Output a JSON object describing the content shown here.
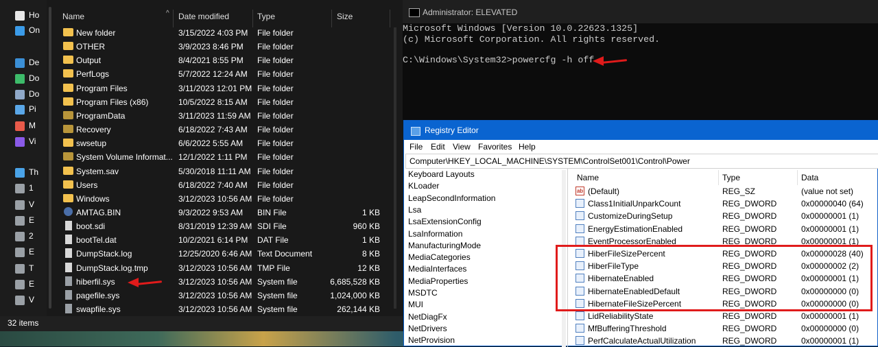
{
  "explorer": {
    "nav": [
      {
        "label": "Ho",
        "icon": "home-icon"
      },
      {
        "label": "On",
        "icon": "onedrive-icon"
      },
      {
        "label": "De",
        "icon": "desktop-icon"
      },
      {
        "label": "Do",
        "icon": "downloads-icon"
      },
      {
        "label": "Do",
        "icon": "documents-icon"
      },
      {
        "label": "Pi",
        "icon": "pictures-icon"
      },
      {
        "label": "M",
        "icon": "music-icon"
      },
      {
        "label": "Vi",
        "icon": "videos-icon"
      },
      {
        "label": "Th",
        "icon": "this-pc-icon"
      },
      {
        "label": "1",
        "icon": "drive-icon"
      },
      {
        "label": "V",
        "icon": "drive-icon"
      },
      {
        "label": "E",
        "icon": "drive-icon"
      },
      {
        "label": "2",
        "icon": "drive-icon"
      },
      {
        "label": "E",
        "icon": "drive-icon"
      },
      {
        "label": "T",
        "icon": "drive-icon"
      },
      {
        "label": "E",
        "icon": "drive-icon"
      },
      {
        "label": "V",
        "icon": "drive-icon"
      }
    ],
    "columns": {
      "name": "Name",
      "date": "Date modified",
      "type": "Type",
      "size": "Size"
    },
    "files": [
      {
        "name": "New folder",
        "date": "3/15/2022 4:03 PM",
        "type": "File folder",
        "size": "",
        "icon": "folder-icon"
      },
      {
        "name": "OTHER",
        "date": "3/9/2023 8:46 PM",
        "type": "File folder",
        "size": "",
        "icon": "folder-icon"
      },
      {
        "name": "Output",
        "date": "8/4/2021 8:55 PM",
        "type": "File folder",
        "size": "",
        "icon": "folder-icon"
      },
      {
        "name": "PerfLogs",
        "date": "5/7/2022 12:24 AM",
        "type": "File folder",
        "size": "",
        "icon": "folder-icon"
      },
      {
        "name": "Program Files",
        "date": "3/11/2023 12:01 PM",
        "type": "File folder",
        "size": "",
        "icon": "folder-icon"
      },
      {
        "name": "Program Files (x86)",
        "date": "10/5/2022 8:15 AM",
        "type": "File folder",
        "size": "",
        "icon": "folder-icon"
      },
      {
        "name": "ProgramData",
        "date": "3/11/2023 11:59 AM",
        "type": "File folder",
        "size": "",
        "icon": "folder-dim-icon"
      },
      {
        "name": "Recovery",
        "date": "6/18/2022 7:43 AM",
        "type": "File folder",
        "size": "",
        "icon": "folder-dim-icon"
      },
      {
        "name": "swsetup",
        "date": "6/6/2022 5:55 AM",
        "type": "File folder",
        "size": "",
        "icon": "folder-icon"
      },
      {
        "name": "System Volume Informat...",
        "date": "12/1/2022 1:11 PM",
        "type": "File folder",
        "size": "",
        "icon": "folder-dim-icon"
      },
      {
        "name": "System.sav",
        "date": "5/30/2018 11:11 AM",
        "type": "File folder",
        "size": "",
        "icon": "folder-icon"
      },
      {
        "name": "Users",
        "date": "6/18/2022 7:40 AM",
        "type": "File folder",
        "size": "",
        "icon": "folder-icon"
      },
      {
        "name": "Windows",
        "date": "3/12/2023 10:56 AM",
        "type": "File folder",
        "size": "",
        "icon": "folder-icon"
      },
      {
        "name": "AMTAG.BIN",
        "date": "9/3/2022 9:53 AM",
        "type": "BIN File",
        "size": "1 KB",
        "icon": "bin-file-icon"
      },
      {
        "name": "boot.sdi",
        "date": "8/31/2019 12:39 AM",
        "type": "SDI File",
        "size": "960 KB",
        "icon": "file-icon"
      },
      {
        "name": "bootTel.dat",
        "date": "10/2/2021 6:14 PM",
        "type": "DAT File",
        "size": "1 KB",
        "icon": "file-icon"
      },
      {
        "name": "DumpStack.log",
        "date": "12/25/2020 6:46 AM",
        "type": "Text Document",
        "size": "8 KB",
        "icon": "file-icon"
      },
      {
        "name": "DumpStack.log.tmp",
        "date": "3/12/2023 10:56 AM",
        "type": "TMP File",
        "size": "12 KB",
        "icon": "file-icon"
      },
      {
        "name": "hiberfil.sys",
        "date": "3/12/2023 10:56 AM",
        "type": "System file",
        "size": "6,685,528 KB",
        "icon": "system-file-icon"
      },
      {
        "name": "pagefile.sys",
        "date": "3/12/2023 10:56 AM",
        "type": "System file",
        "size": "1,024,000 KB",
        "icon": "system-file-icon"
      },
      {
        "name": "swapfile.sys",
        "date": "3/12/2023 10:56 AM",
        "type": "System file",
        "size": "262,144 KB",
        "icon": "system-file-icon"
      }
    ],
    "status": "32 items"
  },
  "cmd": {
    "title": "Administrator: ELEVATED",
    "lines": [
      "Microsoft Windows [Version 10.0.22623.1325]",
      "(c) Microsoft Corporation. All rights reserved.",
      "",
      "C:\\Windows\\System32>powercfg -h off"
    ]
  },
  "regedit": {
    "title": "Registry Editor",
    "menu": [
      "File",
      "Edit",
      "View",
      "Favorites",
      "Help"
    ],
    "address": "Computer\\HKEY_LOCAL_MACHINE\\SYSTEM\\ControlSet001\\Control\\Power",
    "tree": [
      "Keyboard Layouts",
      "KLoader",
      "LeapSecondInformation",
      "Lsa",
      "LsaExtensionConfig",
      "LsaInformation",
      "ManufacturingMode",
      "MediaCategories",
      "MediaInterfaces",
      "MediaProperties",
      "MSDTC",
      "MUI",
      "NetDiagFx",
      "NetDrivers",
      "NetProvision"
    ],
    "columns": {
      "name": "Name",
      "type": "Type",
      "data": "Data"
    },
    "values": [
      {
        "name": "(Default)",
        "type": "REG_SZ",
        "data": "(value not set)",
        "icon": "string-value-icon"
      },
      {
        "name": "Class1InitialUnparkCount",
        "type": "REG_DWORD",
        "data": "0x00000040 (64)",
        "icon": "dword-value-icon"
      },
      {
        "name": "CustomizeDuringSetup",
        "type": "REG_DWORD",
        "data": "0x00000001 (1)",
        "icon": "dword-value-icon"
      },
      {
        "name": "EnergyEstimationEnabled",
        "type": "REG_DWORD",
        "data": "0x00000001 (1)",
        "icon": "dword-value-icon"
      },
      {
        "name": "EventProcessorEnabled",
        "type": "REG_DWORD",
        "data": "0x00000001 (1)",
        "icon": "dword-value-icon"
      },
      {
        "name": "HiberFileSizePercent",
        "type": "REG_DWORD",
        "data": "0x00000028 (40)",
        "icon": "dword-value-icon"
      },
      {
        "name": "HiberFileType",
        "type": "REG_DWORD",
        "data": "0x00000002 (2)",
        "icon": "dword-value-icon"
      },
      {
        "name": "HibernateEnabled",
        "type": "REG_DWORD",
        "data": "0x00000001 (1)",
        "icon": "dword-value-icon"
      },
      {
        "name": "HibernateEnabledDefault",
        "type": "REG_DWORD",
        "data": "0x00000000 (0)",
        "icon": "dword-value-icon"
      },
      {
        "name": "HibernateFileSizePercent",
        "type": "REG_DWORD",
        "data": "0x00000000 (0)",
        "icon": "dword-value-icon"
      },
      {
        "name": "LidReliabilityState",
        "type": "REG_DWORD",
        "data": "0x00000001 (1)",
        "icon": "dword-value-icon"
      },
      {
        "name": "MfBufferingThreshold",
        "type": "REG_DWORD",
        "data": "0x00000000 (0)",
        "icon": "dword-value-icon"
      },
      {
        "name": "PerfCalculateActualUtilization",
        "type": "REG_DWORD",
        "data": "0x00000001 (1)",
        "icon": "dword-value-icon"
      }
    ]
  },
  "annotation_color": "#e01b1b"
}
